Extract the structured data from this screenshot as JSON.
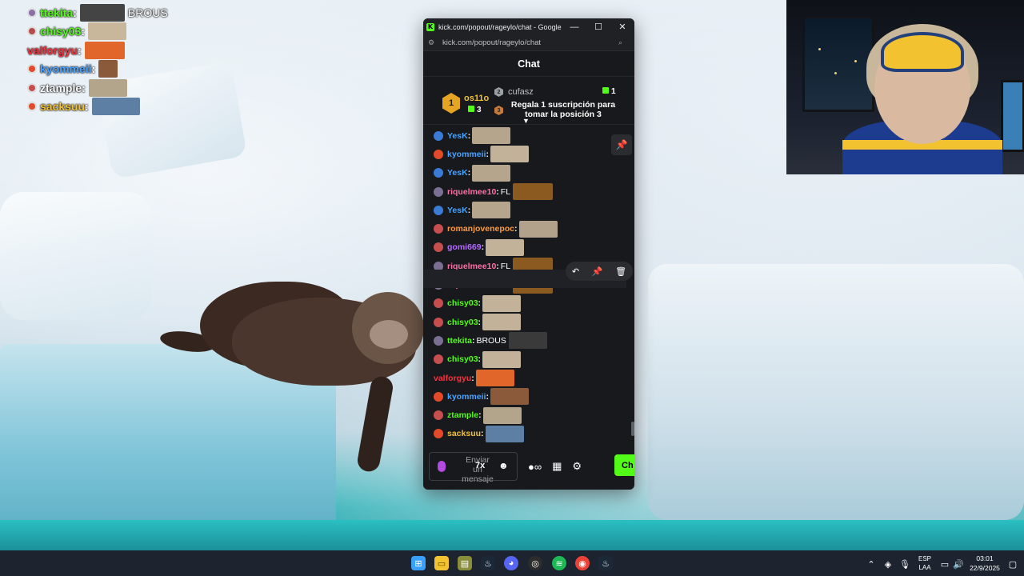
{
  "overlay_chat": [
    {
      "user": "ttekita",
      "color": "#53fc18",
      "badge_color": "#8a6fa8",
      "emote_color": "#444",
      "emote_width": 56,
      "text": "BROUS"
    },
    {
      "user": "chisy03",
      "color": "#53fc18",
      "badge_color": "#b74b4b",
      "emote_color": "#c9b79c",
      "emote_width": 48,
      "text": ""
    },
    {
      "user": "valforgyu",
      "color": "#ff2e3b",
      "badge_color": "",
      "emote_color": "#e0662a",
      "emote_width": 50,
      "text": ""
    },
    {
      "user": "kyommeii",
      "color": "#4aa3ff",
      "badge_color": "#e24a2a",
      "emote_color": "#8a5a3a",
      "emote_width": 24,
      "text": ""
    },
    {
      "user": "ztample",
      "color": "#ffffff",
      "badge_color": "#c74e4e",
      "emote_color": "#b3a48c",
      "emote_width": 48,
      "text": ""
    },
    {
      "user": "sacksuu",
      "color": "#f2c230",
      "badge_color": "#e24a2a",
      "emote_color": "#5d7fa3",
      "emote_width": 60,
      "text": ""
    }
  ],
  "window": {
    "title": "kick.com/popout/rageylo/chat - Google C...",
    "url": "kick.com/popout/rageylo/chat",
    "minimize": "—",
    "maximize": "☐",
    "close": "✕"
  },
  "chat": {
    "header": "Chat",
    "leaderboard": {
      "first": {
        "rank": "1",
        "name": "os11o",
        "count": "3"
      },
      "second": {
        "rank": "2",
        "name": "cufasz",
        "count": "1"
      },
      "third": {
        "rank": "3",
        "text": "Regala 1 suscripción para tomar la posición 3"
      }
    },
    "messages": [
      {
        "user": "YesK",
        "color": "#4aa3ff",
        "badge": "#3a7bd5",
        "text": "",
        "emotes": [
          "#b6a58d"
        ]
      },
      {
        "user": "kyommeii",
        "color": "#4aa3ff",
        "badge": "#e24a2a",
        "text": "",
        "emotes": [
          "#c3b29a"
        ]
      },
      {
        "user": "YesK",
        "color": "#4aa3ff",
        "badge": "#3a7bd5",
        "text": "",
        "emotes": [
          "#b6a58d"
        ]
      },
      {
        "user": "riquelmee10",
        "color": "#ff6fa8",
        "badge": "#7d6f94",
        "text": "FL",
        "emotes": [
          "#8a5a20"
        ]
      },
      {
        "user": "YesK",
        "color": "#4aa3ff",
        "badge": "#3a7bd5",
        "text": "",
        "emotes": [
          "#b6a58d"
        ]
      },
      {
        "user": "romanjovenepoc",
        "color": "#ff9a3c",
        "badge": "#c74e4e",
        "text": "",
        "emotes": [
          "#b3a28b"
        ]
      },
      {
        "user": "gomi669",
        "color": "#b36bff",
        "badge": "#c74e4e",
        "text": "",
        "emotes": [
          "#c3b29a"
        ]
      },
      {
        "user": "riquelmee10",
        "color": "#ff6fa8",
        "badge": "#7d6f94",
        "text": "FL",
        "emotes": [
          "#8a5a20"
        ]
      },
      {
        "user": "riquelmee10",
        "color": "#ff6fa8",
        "badge": "#7d6f94",
        "text": "FL",
        "emotes": [
          "#8a5a20"
        ]
      },
      {
        "user": "chisy03",
        "color": "#53fc18",
        "badge": "#c74e4e",
        "text": "",
        "emotes": [
          "#c3b29a"
        ]
      },
      {
        "user": "chisy03",
        "color": "#53fc18",
        "badge": "#c74e4e",
        "text": "",
        "emotes": [
          "#c3b29a"
        ]
      },
      {
        "user": "ttekita",
        "color": "#53fc18",
        "badge": "#7d6f94",
        "text": "BROUS",
        "emotes": [
          "#3a3a3a"
        ]
      },
      {
        "user": "chisy03",
        "color": "#53fc18",
        "badge": "#c74e4e",
        "text": "",
        "emotes": [
          "#c3b29a"
        ]
      },
      {
        "user": "valforgyu",
        "color": "#ff2e3b",
        "badge": "",
        "text": "",
        "emotes": [
          "#e0662a"
        ]
      },
      {
        "user": "kyommeii",
        "color": "#4aa3ff",
        "badge": "#e24a2a",
        "text": "",
        "emotes": [
          "#8a5a3a"
        ]
      },
      {
        "user": "ztample",
        "color": "#53fc18",
        "badge": "#c74e4e",
        "text": "",
        "emotes": [
          "#b3a48c"
        ]
      },
      {
        "user": "sacksuu",
        "color": "#f2c230",
        "badge": "#e24a2a",
        "text": "",
        "emotes": [
          "#5d7fa3"
        ]
      }
    ],
    "input_placeholder": "Enviar un mensaje",
    "send_label": "Ch"
  },
  "taskbar": {
    "language": "ESP",
    "layout": "LAA",
    "time": "03:01",
    "date": "22/9/2025"
  }
}
